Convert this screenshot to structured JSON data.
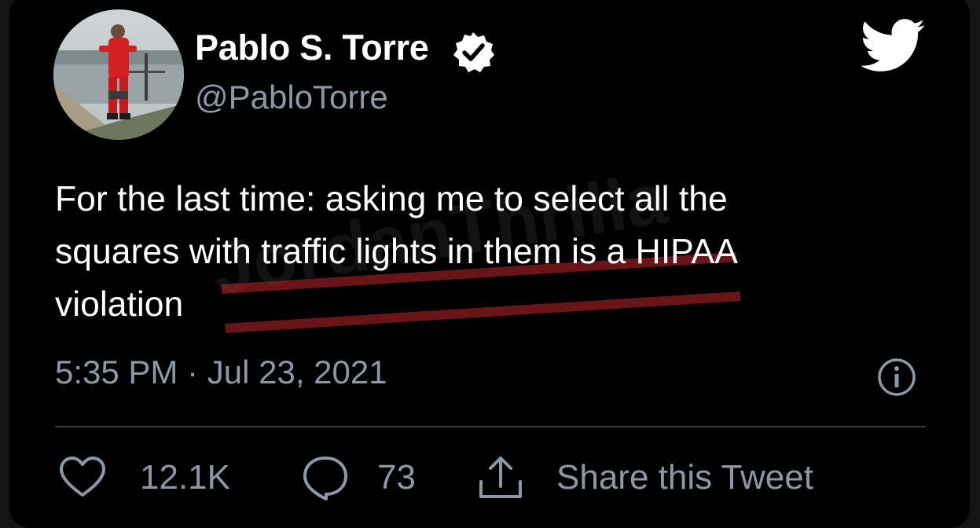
{
  "tweet": {
    "author": {
      "display_name": "Pablo S. Torre",
      "handle": "@PabloTorre",
      "verified": true
    },
    "text_lines": [
      "For the last time: asking me to select all the",
      "squares with traffic lights in them is a HIPAA",
      "violation"
    ],
    "timestamp": "5:35 PM · Jul 23, 2021",
    "watermark": "JordanThrilla"
  },
  "actions": {
    "likes": "12.1K",
    "replies": "73",
    "share_label": "Share this Tweet"
  },
  "icons": {
    "logo": "twitter-bird-icon",
    "verified": "verified-badge-icon",
    "info": "info-icon",
    "like": "heart-icon",
    "reply": "reply-bubble-icon",
    "share": "share-icon"
  },
  "colors": {
    "background": "#000000",
    "text": "#ffffff",
    "muted": "#8b98a5",
    "divider": "#3a3f44",
    "watermark": "#c0262c"
  }
}
